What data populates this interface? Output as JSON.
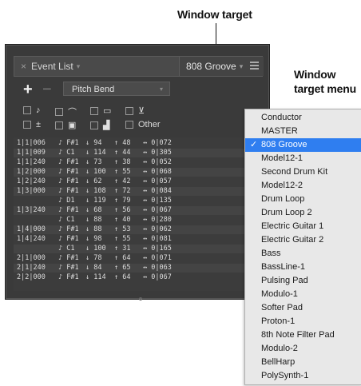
{
  "callouts": {
    "window_target": "Window target",
    "menu_line1": "Window",
    "menu_line2": "target menu"
  },
  "window": {
    "tab_label": "Event List",
    "target_label": "808 Groove",
    "event_type": "Pitch Bend",
    "filter_other": "Other"
  },
  "icons": {
    "close": "×",
    "caret": "▾",
    "note": "♪",
    "bend": "⌒",
    "program": "▭",
    "aftertouch": "⊻",
    "controller": "±",
    "sysex": "▣",
    "poly": "▟"
  },
  "events": [
    {
      "time": "1|1|006",
      "note": "F#1",
      "vel": "94",
      "rel": "48",
      "dur": "0|072"
    },
    {
      "time": "1|1|009",
      "note": "C1",
      "vel": "114",
      "rel": "44",
      "dur": "0|305"
    },
    {
      "time": "1|1|240",
      "note": "F#1",
      "vel": "73",
      "rel": "38",
      "dur": "0|052"
    },
    {
      "time": "1|2|000",
      "note": "F#1",
      "vel": "100",
      "rel": "55",
      "dur": "0|068"
    },
    {
      "time": "1|2|240",
      "note": "F#1",
      "vel": "62",
      "rel": "42",
      "dur": "0|057"
    },
    {
      "time": "1|3|000",
      "note": "F#1",
      "vel": "108",
      "rel": "72",
      "dur": "0|084"
    },
    {
      "time": "",
      "note": "D1",
      "vel": "119",
      "rel": "79",
      "dur": "0|135"
    },
    {
      "time": "1|3|240",
      "note": "F#1",
      "vel": "68",
      "rel": "56",
      "dur": "0|067"
    },
    {
      "time": "",
      "note": "C1",
      "vel": "88",
      "rel": "40",
      "dur": "0|280"
    },
    {
      "time": "1|4|000",
      "note": "F#1",
      "vel": "88",
      "rel": "53",
      "dur": "0|062"
    },
    {
      "time": "1|4|240",
      "note": "F#1",
      "vel": "98",
      "rel": "55",
      "dur": "0|081"
    },
    {
      "time": "",
      "note": "C1",
      "vel": "100",
      "rel": "31",
      "dur": "0|165"
    },
    {
      "time": "2|1|000",
      "note": "F#1",
      "vel": "78",
      "rel": "64",
      "dur": "0|071"
    },
    {
      "time": "2|1|240",
      "note": "F#1",
      "vel": "84",
      "rel": "65",
      "dur": "0|063"
    },
    {
      "time": "2|2|000",
      "note": "F#1",
      "vel": "114",
      "rel": "64",
      "dur": "0|067"
    }
  ],
  "menu": {
    "items": [
      "Conductor",
      "MASTER",
      "808 Groove",
      "Model12-1",
      "Second Drum Kit",
      "Model12-2",
      "Drum Loop",
      "Drum Loop 2",
      "Electric Guitar 1",
      "Electric Guitar 2",
      "Bass",
      "BassLine-1",
      "Pulsing Pad",
      "Modulo-1",
      "Softer Pad",
      "Proton-1",
      "8th Note Filter Pad",
      "Modulo-2",
      "BellHarp",
      "PolySynth-1"
    ],
    "selected_index": 2,
    "check_mark": "✓"
  },
  "colors": {
    "selection": "#2f7ef0",
    "window_bg": "#3a3a3a",
    "menu_bg": "#e8e8e8"
  }
}
